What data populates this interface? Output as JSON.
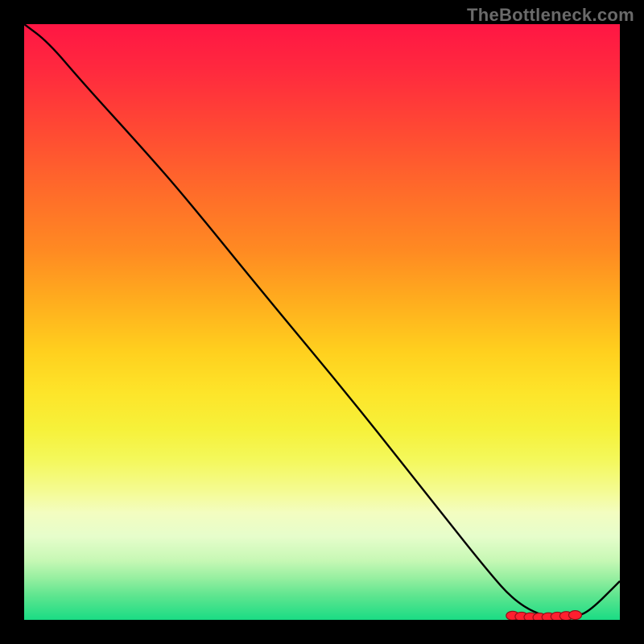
{
  "watermark": "TheBottleneck.com",
  "colors": {
    "background": "#000000",
    "curve": "#000000",
    "marker_fill": "#ff1f2f",
    "marker_stroke": "#901018"
  },
  "chart_data": {
    "type": "line",
    "title": "",
    "xlabel": "",
    "ylabel": "",
    "xlim": [
      0,
      100
    ],
    "ylim": [
      0,
      100
    ],
    "x": [
      0,
      4,
      10,
      20,
      27,
      40,
      55,
      70,
      78,
      82,
      86,
      90,
      92.5,
      95,
      100
    ],
    "y": [
      100,
      97,
      90,
      79,
      71,
      55,
      37,
      18,
      8,
      3.5,
      1,
      0.2,
      0.5,
      1.5,
      6.5
    ],
    "markers": {
      "x": [
        82,
        83.5,
        85,
        86.5,
        88,
        89.5,
        91,
        92.5
      ],
      "y": [
        0.7,
        0.55,
        0.45,
        0.4,
        0.45,
        0.55,
        0.65,
        0.8
      ]
    },
    "gradient_stops": [
      {
        "pos": 0,
        "color": "#ff1644"
      },
      {
        "pos": 55,
        "color": "#ffd01e"
      },
      {
        "pos": 78,
        "color": "#f4fb8e"
      },
      {
        "pos": 100,
        "color": "#1adc84"
      }
    ]
  }
}
